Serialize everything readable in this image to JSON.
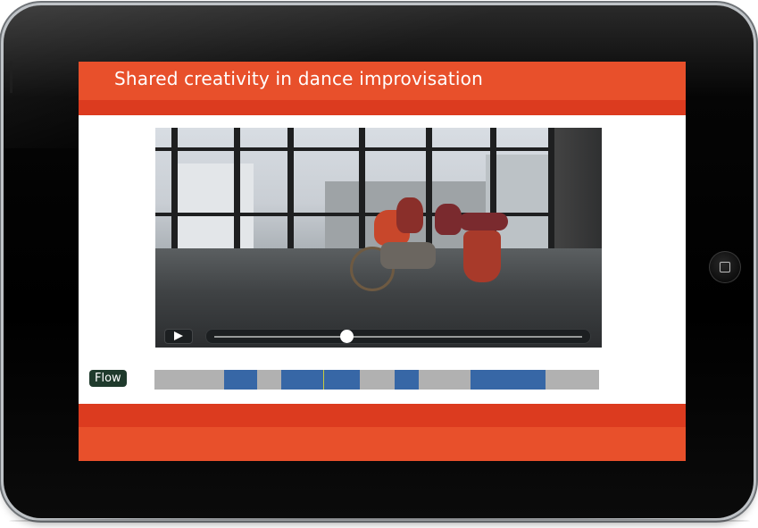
{
  "slide": {
    "title": "Shared creativity in dance improvisation",
    "header_color": "#e8502b",
    "accent_strip_color": "#dc3b1f"
  },
  "video": {
    "play_icon": "play-icon",
    "playback_progress": 0.36
  },
  "flow": {
    "label": "Flow",
    "label_bg_color": "#1f3a2c",
    "track_color": "#b1b1b1",
    "segment_color": "#3767a6",
    "segments": [
      {
        "start": 0.156,
        "end": 0.23
      },
      {
        "start": 0.285,
        "end": 0.462
      },
      {
        "start": 0.54,
        "end": 0.594
      },
      {
        "start": 0.71,
        "end": 0.88
      }
    ],
    "playhead": 0.38
  },
  "device": {
    "home_button_icon": "home-square-icon"
  }
}
